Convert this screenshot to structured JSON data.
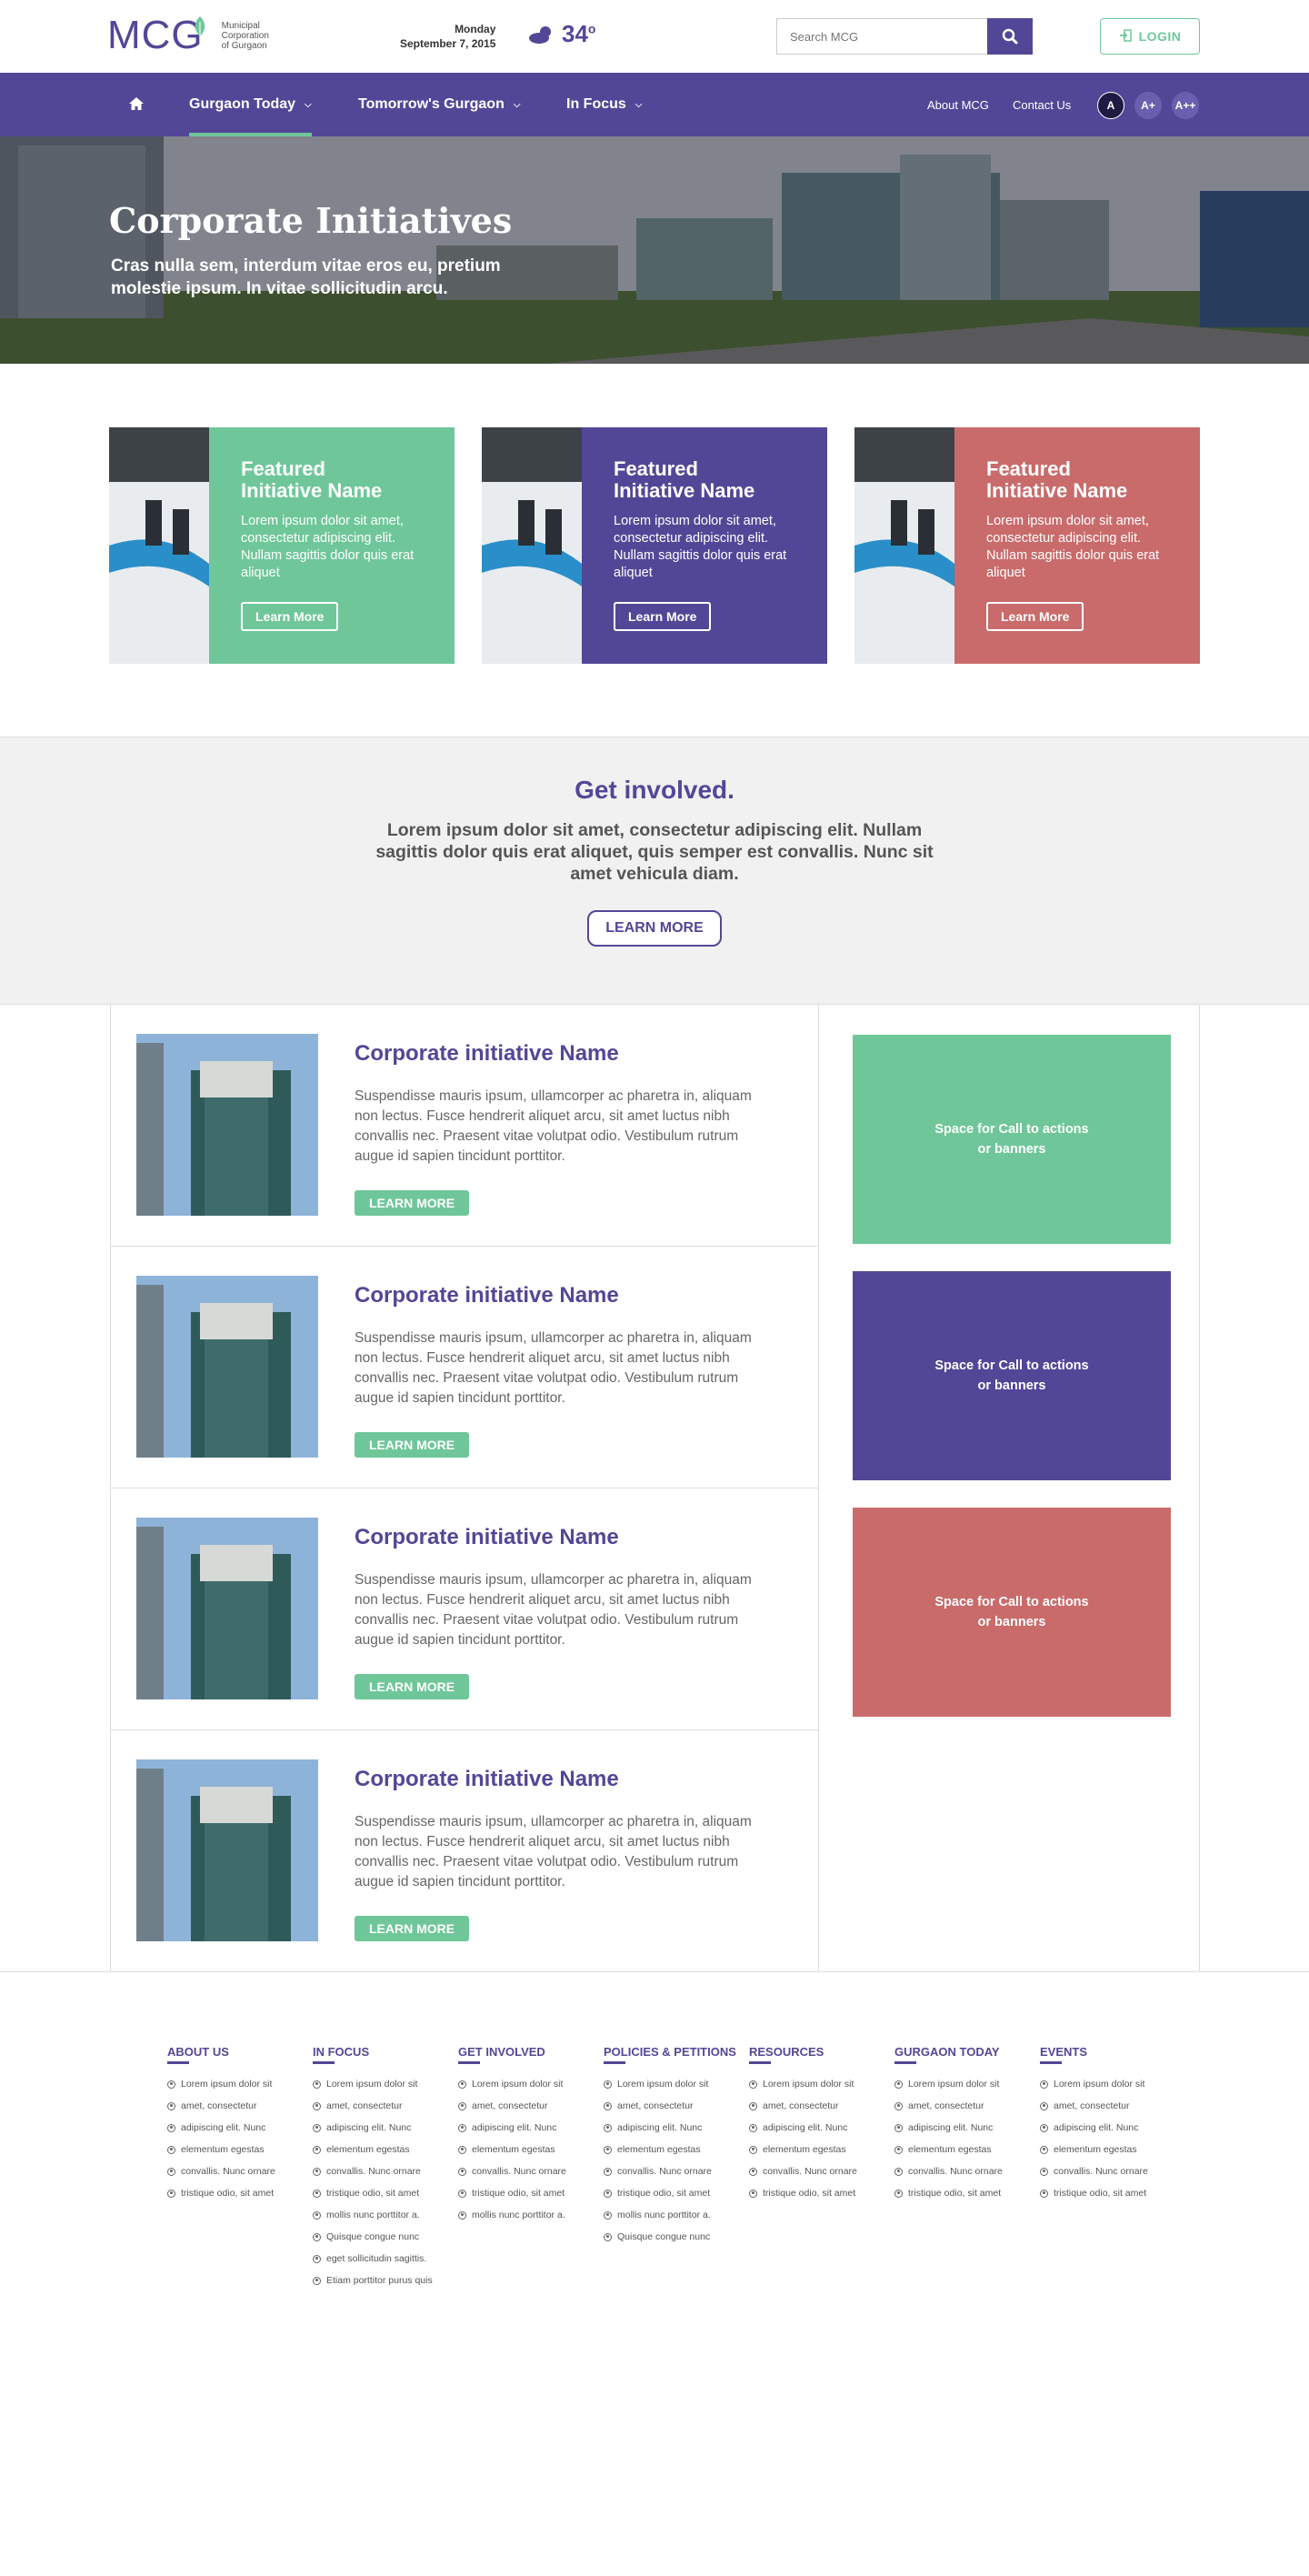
{
  "header": {
    "logo_text": "MCG",
    "logo_caption_1": "Municipal",
    "logo_caption_2": "Corporation",
    "logo_caption_3": "of Gurgaon",
    "day": "Monday",
    "date": "September 7, 2015",
    "temperature": "34",
    "temperature_unit": "o",
    "search_placeholder": "Search MCG",
    "login_label": "LOGIN"
  },
  "nav": {
    "items": [
      {
        "label": "Gurgaon Today"
      },
      {
        "label": "Tomorrow's Gurgaon"
      },
      {
        "label": "In Focus"
      }
    ],
    "right_links": [
      "About MCG",
      "Contact Us"
    ],
    "font_sizes": [
      "A",
      "A+",
      "A++"
    ]
  },
  "hero": {
    "title": "Corporate Initiatives",
    "subtitle": "Cras nulla sem, interdum vitae eros eu, pretium molestie ipsum. In vitae sollicitudin arcu."
  },
  "featured": [
    {
      "title_1": "Featured",
      "title_2": "Initiative Name",
      "text": "Lorem ipsum dolor sit amet, consectetur adipiscing elit. Nullam sagittis dolor quis erat aliquet",
      "button": "Learn More",
      "color": "#6fc799"
    },
    {
      "title_1": "Featured",
      "title_2": "Initiative Name",
      "text": "Lorem ipsum dolor sit amet, consectetur adipiscing elit. Nullam sagittis dolor quis erat aliquet",
      "button": "Learn More",
      "color": "#524797"
    },
    {
      "title_1": "Featured",
      "title_2": "Initiative Name",
      "text": "Lorem ipsum dolor sit amet, consectetur adipiscing elit. Nullam sagittis dolor quis erat aliquet",
      "button": "Learn More",
      "color": "#c96b6b"
    }
  ],
  "involved": {
    "title": "Get involved.",
    "text": "Lorem ipsum dolor sit amet, consectetur adipiscing elit. Nullam sagittis dolor quis erat aliquet, quis semper est convallis. Nunc sit amet vehicula diam.",
    "button": "LEARN MORE"
  },
  "initiatives": [
    {
      "title": "Corporate initiative Name",
      "text": "Suspendisse mauris ipsum, ullamcorper ac pharetra in, aliquam non lectus. Fusce hendrerit aliquet arcu, sit amet luctus nibh convallis nec. Praesent vitae volutpat odio. Vestibulum rutrum augue id sapien tincidunt porttitor.",
      "button": "LEARN MORE"
    },
    {
      "title": "Corporate initiative Name",
      "text": "Suspendisse mauris ipsum, ullamcorper ac pharetra in, aliquam non lectus. Fusce hendrerit aliquet arcu, sit amet luctus nibh convallis nec. Praesent vitae volutpat odio. Vestibulum rutrum augue id sapien tincidunt porttitor.",
      "button": "LEARN MORE"
    },
    {
      "title": "Corporate initiative Name",
      "text": "Suspendisse mauris ipsum, ullamcorper ac pharetra in, aliquam non lectus. Fusce hendrerit aliquet arcu, sit amet luctus nibh convallis nec. Praesent vitae volutpat odio. Vestibulum rutrum augue id sapien tincidunt porttitor.",
      "button": "LEARN MORE"
    },
    {
      "title": "Corporate initiative Name",
      "text": "Suspendisse mauris ipsum, ullamcorper ac pharetra in, aliquam non lectus. Fusce hendrerit aliquet arcu, sit amet luctus nibh convallis nec. Praesent vitae volutpat odio. Vestibulum rutrum augue id sapien tincidunt porttitor.",
      "button": "LEARN MORE"
    }
  ],
  "ctas": [
    {
      "line1": "Space for Call to actions",
      "line2": "or banners",
      "color": "#6fc799"
    },
    {
      "line1": "Space for Call to actions",
      "line2": "or banners",
      "color": "#524797"
    },
    {
      "line1": "Space for Call to actions",
      "line2": "or banners",
      "color": "#c96b6b"
    }
  ],
  "footer": {
    "columns": [
      {
        "title": "ABOUT US",
        "items": [
          "Lorem ipsum dolor sit",
          "amet, consectetur",
          "adipiscing elit. Nunc",
          "elementum egestas",
          "convallis. Nunc ornare",
          "tristique odio, sit amet"
        ]
      },
      {
        "title": "IN FOCUS",
        "items": [
          "Lorem ipsum dolor sit",
          "amet, consectetur",
          "adipiscing elit. Nunc",
          "elementum egestas",
          "convallis. Nunc ornare",
          "tristique odio, sit amet",
          "mollis nunc porttitor a.",
          "Quisque congue nunc",
          "eget sollicitudin sagittis.",
          "Etiam porttitor purus quis"
        ]
      },
      {
        "title": "GET INVOLVED",
        "items": [
          "Lorem ipsum dolor sit",
          "amet, consectetur",
          "adipiscing elit. Nunc",
          "elementum egestas",
          "convallis. Nunc ornare",
          "tristique odio, sit amet",
          "mollis nunc porttitor a."
        ]
      },
      {
        "title": "POLICIES & PETITIONS",
        "items": [
          "Lorem ipsum dolor sit",
          "amet, consectetur",
          "adipiscing elit. Nunc",
          "elementum egestas",
          "convallis. Nunc ornare",
          "tristique odio, sit amet",
          "mollis nunc porttitor a.",
          "Quisque congue nunc"
        ]
      },
      {
        "title": "RESOURCES",
        "items": [
          "Lorem ipsum dolor sit",
          "amet, consectetur",
          "adipiscing elit. Nunc",
          "elementum egestas",
          "convallis. Nunc ornare",
          "tristique odio, sit amet"
        ]
      },
      {
        "title": "GURGAON TODAY",
        "items": [
          "Lorem ipsum dolor sit",
          "amet, consectetur",
          "adipiscing elit. Nunc",
          "elementum egestas",
          "convallis. Nunc ornare",
          "tristique odio, sit amet"
        ]
      },
      {
        "title": "EVENTS",
        "items": [
          "Lorem ipsum dolor sit",
          "amet, consectetur",
          "adipiscing elit. Nunc",
          "elementum egestas",
          "convallis. Nunc ornare",
          "tristique odio, sit amet"
        ]
      }
    ]
  },
  "colors": {
    "primary": "#524797",
    "green": "#6fc799",
    "red": "#c96b6b"
  }
}
